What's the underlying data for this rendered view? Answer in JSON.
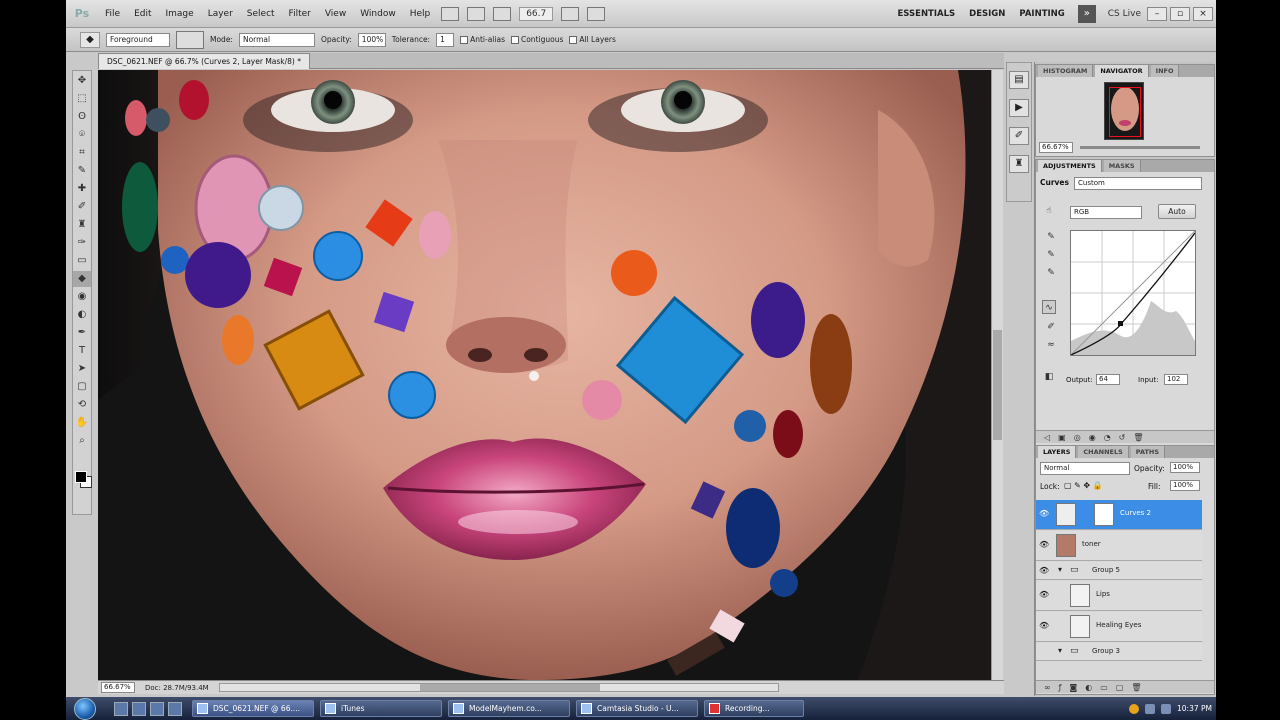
{
  "menubar": {
    "logo": "Ps",
    "items": [
      "File",
      "Edit",
      "Image",
      "Layer",
      "Select",
      "Filter",
      "View",
      "Window",
      "Help"
    ],
    "zoom": "66.7",
    "workspaces": [
      "ESSENTIALS",
      "DESIGN",
      "PAINTING"
    ],
    "cs_live": "CS Live"
  },
  "options": {
    "fill_source": "Foreground",
    "mode_label": "Mode:",
    "mode_value": "Normal",
    "opacity_label": "Opacity:",
    "opacity_value": "100%",
    "tolerance_label": "Tolerance:",
    "tolerance_value": "1",
    "anti_alias": "Anti-alias",
    "contiguous": "Contiguous",
    "all_layers": "All Layers"
  },
  "document": {
    "tab_title": "DSC_0621.NEF @ 66.7% (Curves 2, Layer Mask/8) *",
    "zoom": "66.67%",
    "doc_size": "Doc: 28.7M/93.4M"
  },
  "navigator": {
    "tabs": [
      "HISTOGRAM",
      "NAVIGATOR",
      "INFO"
    ],
    "zoom": "66.67%"
  },
  "adjustments": {
    "tabs": [
      "ADJUSTMENTS",
      "MASKS"
    ],
    "title": "Curves",
    "preset": "Custom",
    "channel": "RGB",
    "auto": "Auto",
    "output_label": "Output:",
    "output_value": "64",
    "input_label": "Input:",
    "input_value": "102"
  },
  "layers": {
    "tabs": [
      "LAYERS",
      "CHANNELS",
      "PATHS"
    ],
    "blend_mode": "Normal",
    "opacity_label": "Opacity:",
    "opacity_value": "100%",
    "lock_label": "Lock:",
    "fill_label": "Fill:",
    "fill_value": "100%",
    "items": [
      {
        "name": "Curves 2"
      },
      {
        "name": "toner"
      },
      {
        "name": "Group 5"
      },
      {
        "name": "Lips"
      },
      {
        "name": "Healing Eyes"
      },
      {
        "name": "Group 3"
      }
    ]
  },
  "taskbar": {
    "tasks": [
      "DSC_0621.NEF @ 66....",
      "iTunes",
      "ModelMayhem.co...",
      "Camtasia Studio - U...",
      "Recording..."
    ],
    "time": "10:37 PM"
  },
  "colors": {
    "selection": "#3b8de6",
    "skin": "#d79d8a",
    "lips": "#c0406e"
  }
}
